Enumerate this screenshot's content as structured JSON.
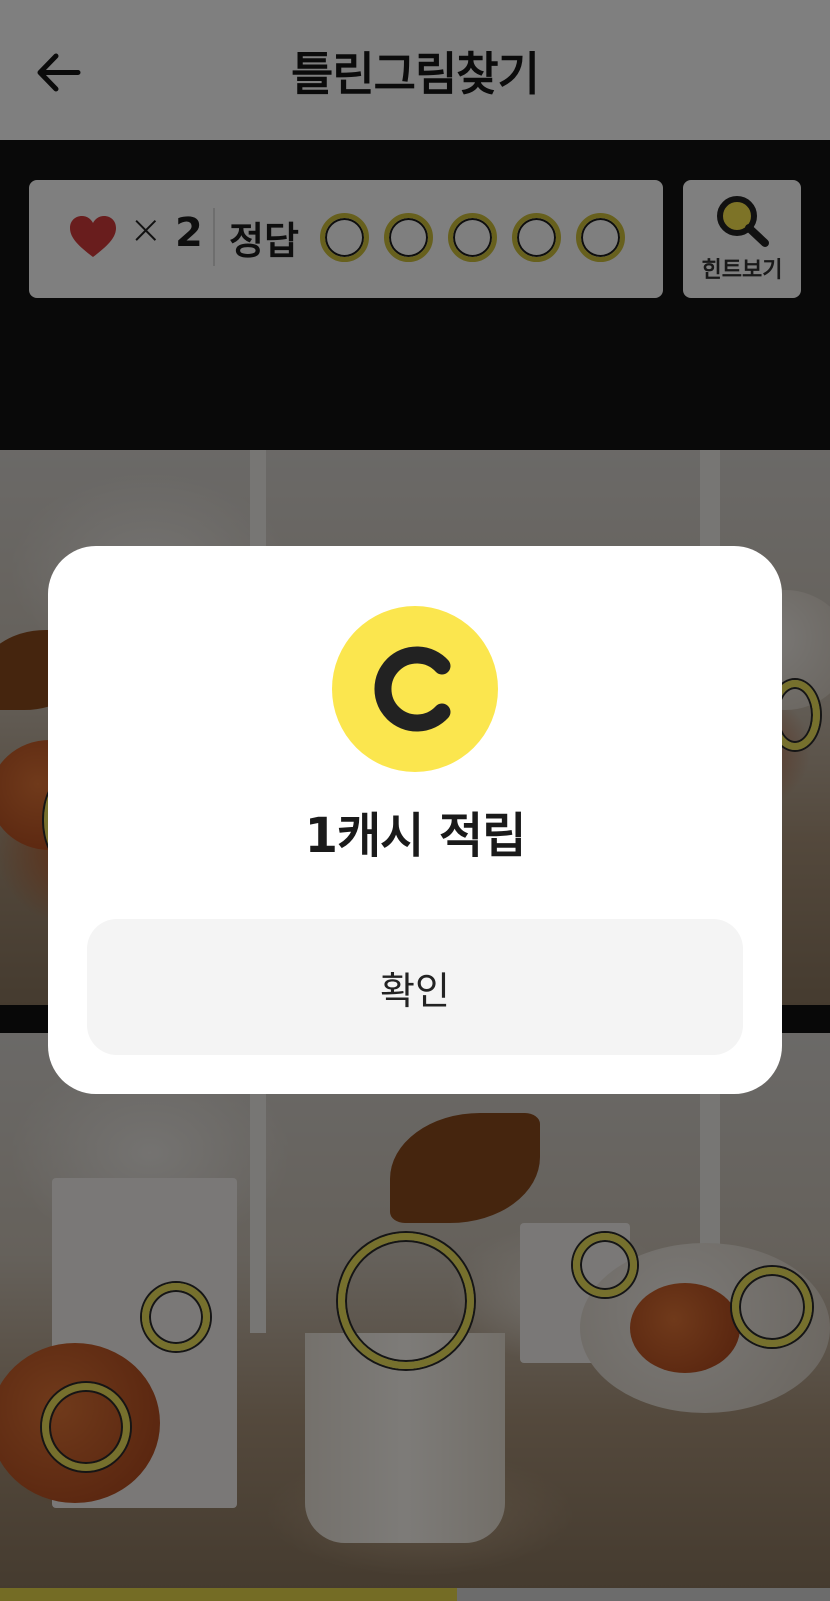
{
  "header": {
    "title": "틀린그림찾기",
    "back_icon": "arrow-left-icon"
  },
  "status": {
    "heart_icon": "heart-icon",
    "times_symbol": "×",
    "lives": "2",
    "answer_label": "정답",
    "answers_total": 5,
    "answers_found": 0
  },
  "hint": {
    "icon": "magnifier-icon",
    "label": "힌트보기"
  },
  "progress": {
    "value_percent": 55
  },
  "dialog": {
    "coin_icon": "cash-coin-icon",
    "message": "1캐시 적립",
    "confirm_label": "확인"
  },
  "colors": {
    "accent_yellow": "#fbe64e",
    "marker_yellow": "#ece05a",
    "heart_red": "#d23a3a",
    "dark_bg": "#121212"
  }
}
